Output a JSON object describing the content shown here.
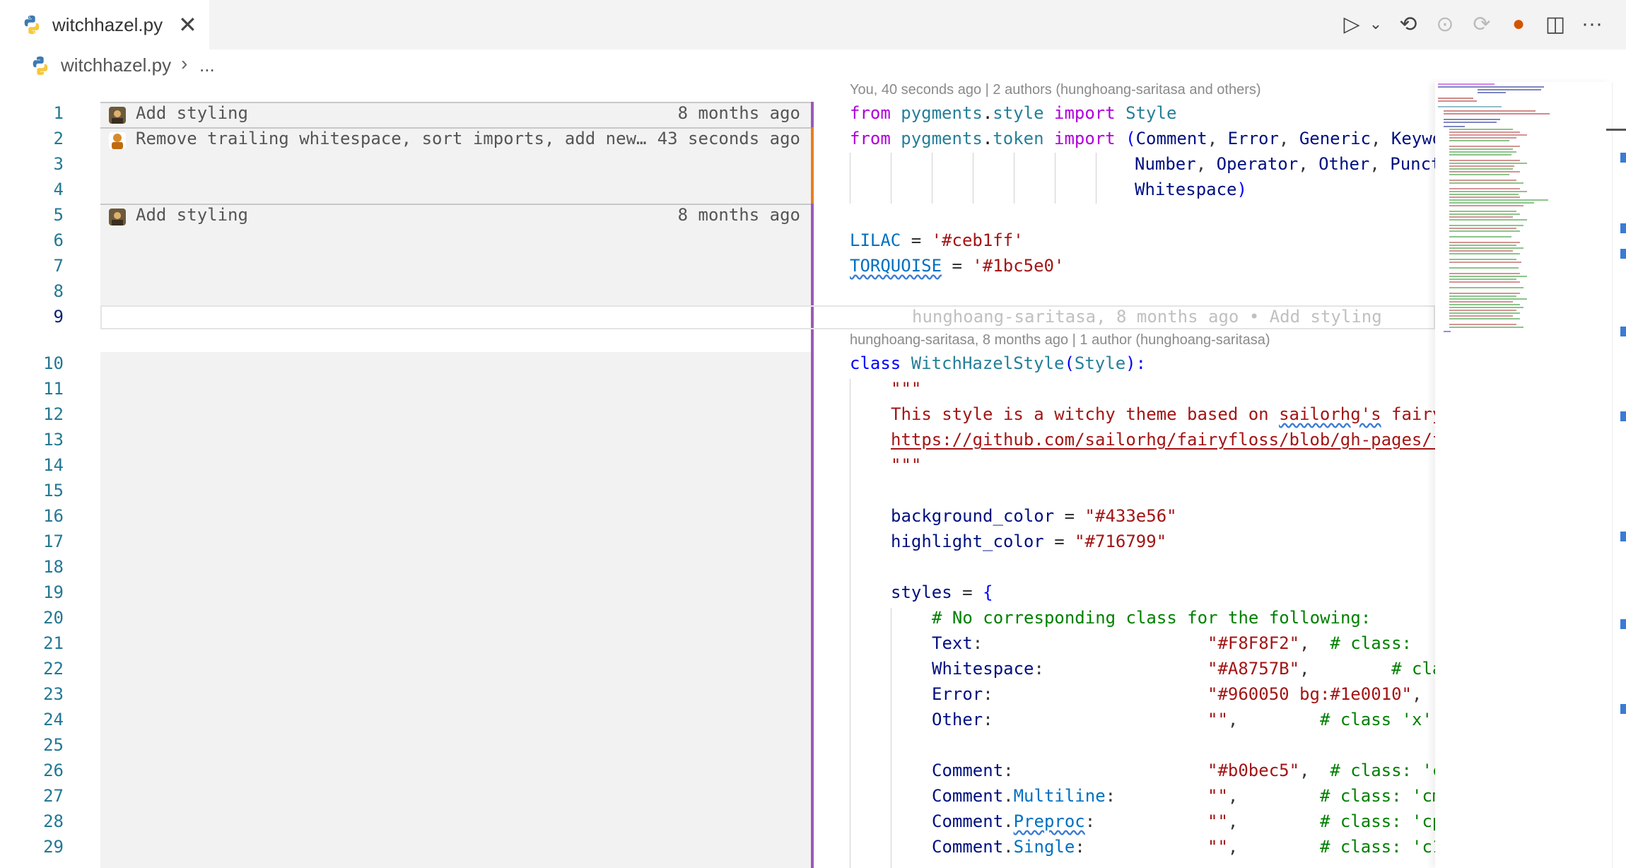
{
  "tab": {
    "label": "witchhazel.py",
    "close": "✕"
  },
  "breadcrumb": {
    "file": "witchhazel.py",
    "sep": "›",
    "more": "..."
  },
  "toolbar": {
    "run": "▷",
    "run_menu": "⌄",
    "back": "⟲",
    "dot": "⊙",
    "forward": "⟳",
    "avatar": "●",
    "split": "◫",
    "more": "···"
  },
  "codelens": {
    "top": "You, 40 seconds ago | 2 authors (hunghoang-saritasa and others)",
    "class": "hunghoang-saritasa, 8 months ago | 1 author (hunghoang-saritasa)"
  },
  "blame": [
    {
      "msg": "Add styling",
      "time": "8 months ago"
    },
    {
      "msg": "Remove trailing whitespace, sort imports, add new…",
      "time": "43 seconds ago"
    },
    {
      "msg": "Add styling",
      "time": "8 months ago"
    }
  ],
  "inline_blame": "hunghoang-saritasa, 8 months ago • Add styling",
  "lines": [
    "1",
    "2",
    "3",
    "4",
    "5",
    "6",
    "7",
    "8",
    "9",
    "10",
    "11",
    "12",
    "13",
    "14",
    "15",
    "16",
    "17",
    "18",
    "19",
    "20",
    "21",
    "22",
    "23",
    "24",
    "25",
    "26",
    "27",
    "28",
    "29"
  ],
  "code": {
    "l1": [
      "from",
      " pygments",
      ".",
      "style",
      " import",
      " Style"
    ],
    "l2": [
      "from",
      " pygments",
      ".",
      "token",
      " import",
      " (",
      "Comment",
      ", ",
      "Error",
      ", ",
      "Generic",
      ", ",
      "Keywo"
    ],
    "l3": [
      "Number",
      ", ",
      "Operator",
      ", ",
      "Other",
      ", ",
      "Punct"
    ],
    "l4": [
      "Whitespace",
      ")"
    ],
    "l6": [
      "LILAC",
      " = ",
      "'#ceb1ff'"
    ],
    "l7": [
      "TORQUOISE",
      " = ",
      "'#1bc5e0'"
    ],
    "l10": [
      "class",
      " ",
      "WitchHazelStyle",
      "(",
      "Style",
      "):"
    ],
    "l11": "\"\"\"",
    "l12a": "This style is a witchy theme based on ",
    "l12b": "sailorhg's",
    "l12c": " fairy",
    "l13": "https://github.com/sailorhg/fairyfloss/blob/gh-pages/f",
    "l14": "\"\"\"",
    "l16": [
      "background_color",
      " = ",
      "\"#433e56\""
    ],
    "l17": [
      "highlight_color",
      " = ",
      "\"#716799\""
    ],
    "l19": [
      "styles",
      " = ",
      "{"
    ],
    "l20": "# No corresponding class for the following:",
    "l21": [
      "Text",
      ":",
      "\"#F8F8F2\"",
      ",  ",
      "# class:"
    ],
    "l22": [
      "Whitespace",
      ":",
      "\"#A8757B\"",
      ",        ",
      "# cla"
    ],
    "l23": [
      "Error",
      ":",
      "\"#960050 bg:#1e0010\"",
      ","
    ],
    "l24": [
      "Other",
      ":",
      "\"\"",
      ",        ",
      "# class 'x'"
    ],
    "l26": [
      "Comment",
      ":",
      "\"#b0bec5\"",
      ",  ",
      "# class: 'c"
    ],
    "l27": [
      "Comment",
      ".",
      "Multiline",
      ":",
      "\"\"",
      ",        ",
      "# class: 'cm"
    ],
    "l28": [
      "Comment",
      ".",
      "Preproc",
      ":",
      "\"\"",
      ",        ",
      "# class: 'cp"
    ],
    "l29": [
      "Comment",
      ".",
      "Single",
      ":",
      "\"\"",
      ",        ",
      "# class: 'c1"
    ]
  },
  "colors": {
    "blame_bar_purple": "#9b59b6",
    "blame_bar_orange": "#e67e22",
    "keyword": "#af00db",
    "string": "#a31515"
  }
}
